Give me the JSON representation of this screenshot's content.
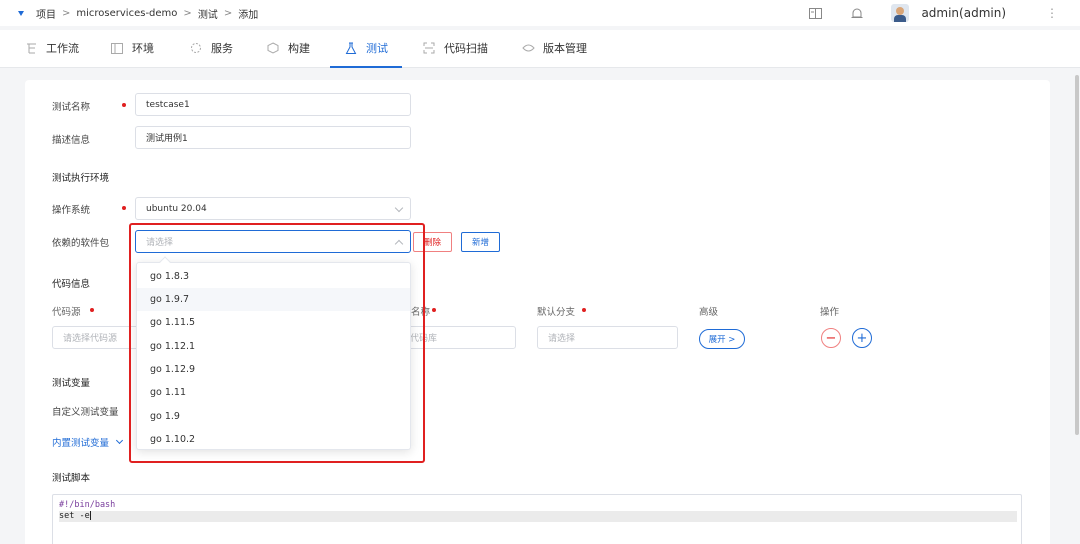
{
  "breadcrumb": {
    "items": [
      "项目",
      "microservices-demo",
      "测试",
      "添加"
    ],
    "separator": ">"
  },
  "user": {
    "name": "admin(admin)"
  },
  "nav": {
    "items": [
      {
        "label": "工作流",
        "icon": "workflow-icon"
      },
      {
        "label": "环境",
        "icon": "environment-icon"
      },
      {
        "label": "服务",
        "icon": "service-icon"
      },
      {
        "label": "构建",
        "icon": "build-icon"
      },
      {
        "label": "测试",
        "icon": "flask-icon",
        "active": true
      },
      {
        "label": "代码扫描",
        "icon": "scan-icon"
      },
      {
        "label": "版本管理",
        "icon": "version-icon"
      }
    ]
  },
  "form": {
    "test_name": {
      "label": "测试名称",
      "value": "testcase1"
    },
    "description": {
      "label": "描述信息",
      "value": "测试用例1"
    },
    "env_section": "测试执行环境",
    "os": {
      "label": "操作系统",
      "value": "ubuntu 20.04"
    },
    "deps": {
      "label": "依赖的软件包",
      "placeholder": "请选择",
      "delete_label": "删除",
      "add_label": "新增"
    },
    "code_section": "代码信息",
    "code_cols": {
      "source": "代码源",
      "repo_suffix": "名称",
      "branch": "默认分支",
      "advanced": "高级",
      "action": "操作"
    },
    "code_row": {
      "source_placeholder": "请选择代码源",
      "repo_placeholder": "代码库",
      "branch_placeholder": "请选择",
      "expand_label": "展开 >"
    },
    "vars_section": "测试变量",
    "custom_vars": "自定义测试变量",
    "builtin_vars": "内置测试变量",
    "script_section": "测试脚本",
    "script_lines": [
      "#!/bin/bash",
      "set -e"
    ]
  },
  "dropdown": {
    "options": [
      "go 1.8.3",
      "go 1.9.7",
      "go 1.11.5",
      "go 1.12.1",
      "go 1.12.9",
      "go 1.11",
      "go 1.9",
      "go 1.10.2"
    ],
    "hovered": "go 1.9.7"
  },
  "colors": {
    "accent": "#1f6bd6",
    "required": "#e02020",
    "highlight": "#e02020"
  }
}
